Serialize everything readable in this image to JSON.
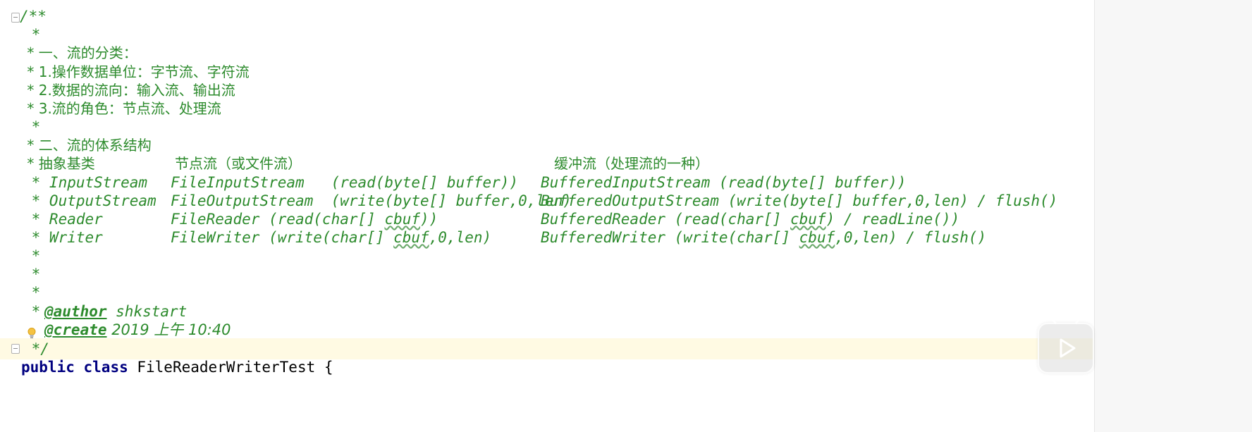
{
  "editor": {
    "comment_lines": [
      "/**",
      " *",
      " * 一、流的分类：",
      " * 1.操作数据单位：字节流、字符流",
      " * 2.数据的流向：输入流、输出流",
      " * 3.流的角色：节点流、处理流",
      " *",
      " * 二、流的体系结构"
    ],
    "table": {
      "header": {
        "abstract": " * 抽象基类",
        "node": "节点流（或文件流）",
        "buffered": "缓冲流（处理流的一种）"
      },
      "rows": [
        {
          "base": " * InputStream",
          "node": "FileInputStream   (read(byte[] buffer))",
          "buffered": "BufferedInputStream (read(byte[] buffer))"
        },
        {
          "base": " * OutputStream",
          "node": "FileOutputStream  (write(byte[] buffer,0,len)",
          "buffered": "BufferedOutputStream (write(byte[] buffer,0,len) / flush()"
        },
        {
          "base": " * Reader",
          "node_prefix": "FileReader (read(char[] ",
          "node_squiggle": "cbuf",
          "node_suffix": "))",
          "buffered_prefix": "BufferedReader (read(char[] ",
          "buffered_squiggle": "cbuf",
          "buffered_suffix": ") / readLine())"
        },
        {
          "base": " * Writer",
          "node_prefix": "FileWriter (write(char[] ",
          "node_squiggle": "cbuf",
          "node_suffix": ",0,len)",
          "buffered_prefix": "BufferedWriter (write(char[] ",
          "buffered_squiggle": "cbuf",
          "buffered_suffix": ",0,len) / flush()"
        }
      ]
    },
    "empty_star": " *",
    "author_tag": "@author",
    "author_value": " shkstart",
    "create_tag": "@create",
    "create_value": " 2019 上午 10:40",
    "comment_end": " */",
    "class_keyword_public": "public",
    "class_keyword_class": "class",
    "class_name": " FileReaderWriterTest {"
  },
  "colors": {
    "comment": "#2d8b2d",
    "keyword": "#000080",
    "current_line": "#fffae3"
  },
  "icons": {
    "fold": "fold-icon",
    "bulb": "intention-bulb-icon",
    "play": "play-button-icon"
  }
}
